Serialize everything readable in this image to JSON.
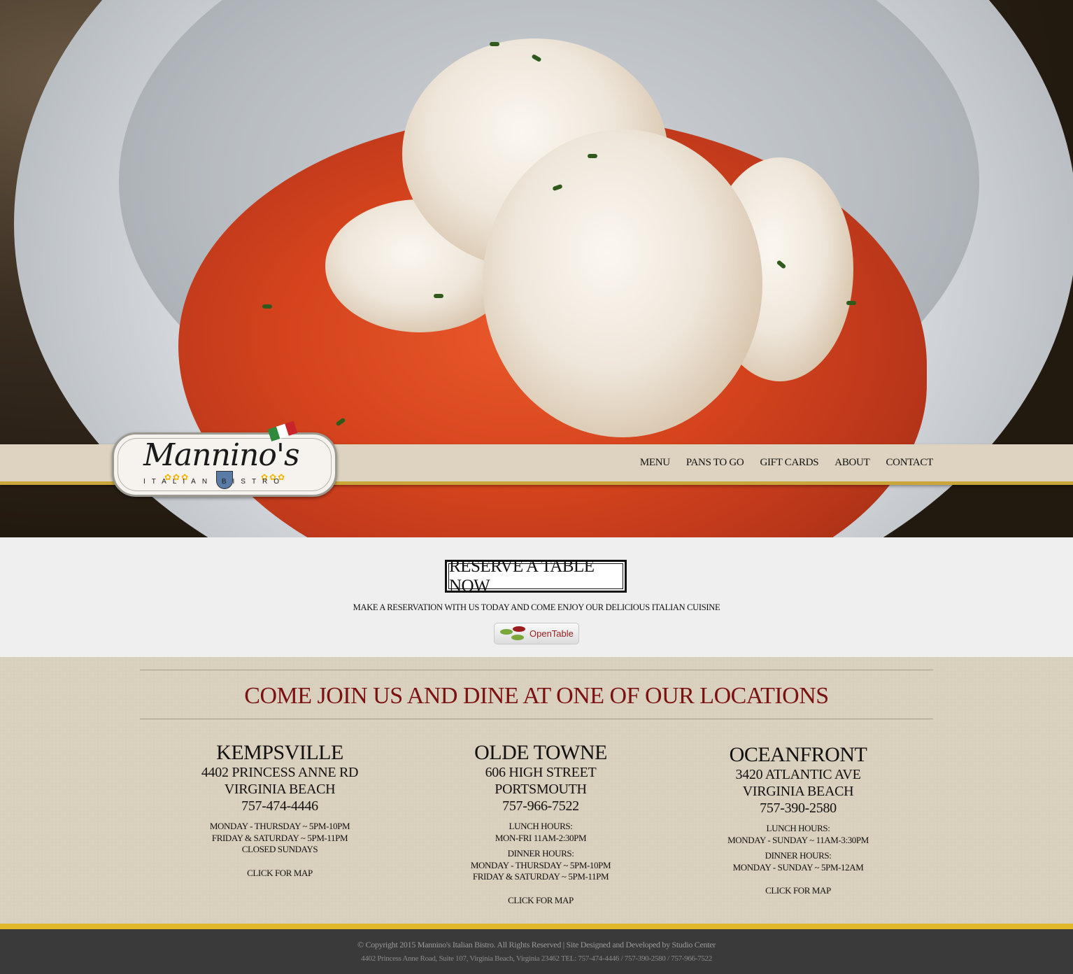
{
  "nav": {
    "items": [
      {
        "label": "MENU"
      },
      {
        "label": "PANS TO GO"
      },
      {
        "label": "GIFT CARDS"
      },
      {
        "label": "ABOUT"
      },
      {
        "label": "CONTACT"
      }
    ]
  },
  "logo": {
    "script": "Mannino's",
    "subtitle": "ITALIAN BISTRO",
    "flag_colors": [
      "#2f8a3c",
      "#ffffff",
      "#c8242a"
    ]
  },
  "reserve": {
    "button_label": "RESERVE A TABLE NOW",
    "text": "MAKE A RESERVATION WITH US TODAY AND COME ENJOY OUR DELICIOUS ITALIAN CUISINE",
    "opentable_label": "OpenTable",
    "opentable_dot_colors": [
      "#7aa63a",
      "#9a1c1c",
      "#7aa63a"
    ]
  },
  "locations": {
    "heading": "COME JOIN US AND DINE AT ONE OF OUR  LOCATIONS",
    "heading_color": "#7b1212",
    "items": [
      {
        "name": "KEMPSVILLE",
        "street": "4402 PRINCESS ANNE RD",
        "city": "VIRGINIA BEACH",
        "phone": "757-474-4446",
        "hours_1": "MONDAY - THURSDAY ~ 5PM-10PM",
        "hours_2": "FRIDAY & SATURDAY  ~ 5PM-11PM",
        "hours_3": "CLOSED SUNDAYS",
        "map": "CLICK FOR MAP"
      },
      {
        "name": "OLDE TOWNE",
        "street": "606 HIGH STREET",
        "city": "PORTSMOUTH",
        "phone": "757-966-7522",
        "lunch_label": "LUNCH HOURS:",
        "lunch_hours": "MON-FRI 11AM-2:30PM",
        "dinner_label": "DINNER HOURS:",
        "dinner_1": "MONDAY - THURSDAY ~ 5PM-10PM",
        "dinner_2": "FRIDAY & SATURDAY  ~ 5PM-11PM",
        "map": "CLICK FOR MAP"
      },
      {
        "name": "OCEANFRONT",
        "street": "3420 ATLANTIC AVE",
        "city": "VIRGINIA BEACH",
        "phone": "757-390-2580",
        "lunch_label": "LUNCH HOURS:",
        "lunch_hours": "MONDAY - SUNDAY ~ 11AM-3:30PM",
        "dinner_label": "DINNER HOURS:",
        "dinner_1": "MONDAY - SUNDAY ~ 5PM-12AM",
        "map": "CLICK FOR MAP"
      }
    ]
  },
  "footer": {
    "line_1": "© Copyright 2015 Mannino's Italian Bistro. All Rights Reserved  |  Site Designed and Developed by Studio Center",
    "line_2": "4402 Princess Anne Road, Suite 107, Virginia Beach, Virginia 23462    TEL: 757-474-4446 / 757-390-2580 / 757-966-7522"
  },
  "colors": {
    "accent_gold": "#e0b82a",
    "footer_bg": "#3a3a3a",
    "nav_bg": "#ddd3c0"
  }
}
